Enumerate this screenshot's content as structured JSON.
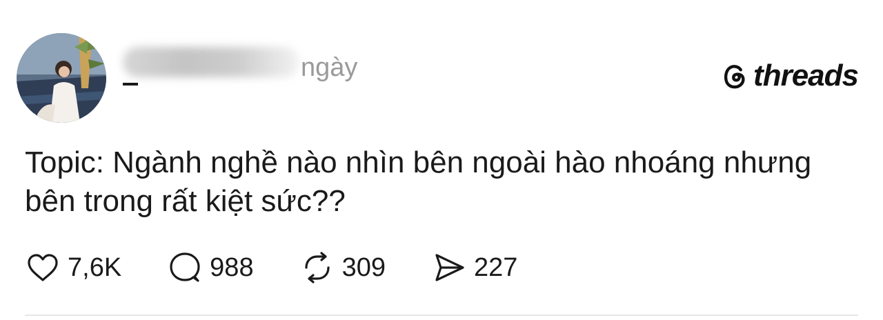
{
  "header": {
    "username_visible_fragment": "_",
    "time_fragment": "ngày"
  },
  "brand": {
    "name": "threads"
  },
  "post": {
    "text": "Topic: Ngành nghề nào nhìn bên ngoài hào nhoáng nhưng bên trong rất kiệt sức??"
  },
  "actions": {
    "likes": "7,6K",
    "replies": "988",
    "reposts": "309",
    "shares": "227"
  },
  "icons": [
    "heart-icon",
    "reply-icon",
    "repost-icon",
    "share-icon",
    "threads-logo-icon"
  ]
}
